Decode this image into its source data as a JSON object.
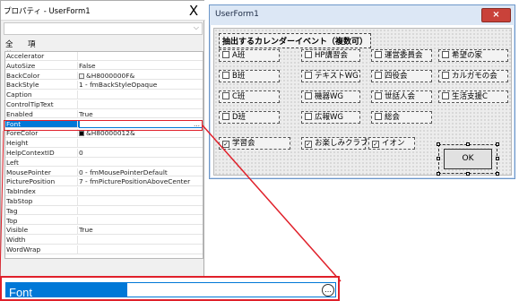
{
  "props": {
    "title": "プロパティ - UserForm1",
    "close": "X",
    "tabs": [
      "全体",
      "項目別"
    ],
    "rows": [
      {
        "name": "Accelerator",
        "value": ""
      },
      {
        "name": "AutoSize",
        "value": "False"
      },
      {
        "name": "BackColor",
        "value": "&H8000000F&",
        "swatch": "#f0f0f0"
      },
      {
        "name": "BackStyle",
        "value": "1 - fmBackStyleOpaque"
      },
      {
        "name": "Caption",
        "value": ""
      },
      {
        "name": "ControlTipText",
        "value": ""
      },
      {
        "name": "Enabled",
        "value": "True"
      },
      {
        "name": "Font",
        "value": "",
        "selected": true,
        "ellipsis": "…"
      },
      {
        "name": "ForeColor",
        "value": "&H80000012&",
        "swatch": "#000000"
      },
      {
        "name": "Height",
        "value": ""
      },
      {
        "name": "HelpContextID",
        "value": "0"
      },
      {
        "name": "Left",
        "value": ""
      },
      {
        "name": "MousePointer",
        "value": "0 - fmMousePointerDefault"
      },
      {
        "name": "PicturePosition",
        "value": "7 - fmPicturePositionAboveCenter"
      },
      {
        "name": "TabIndex",
        "value": ""
      },
      {
        "name": "TabStop",
        "value": ""
      },
      {
        "name": "Tag",
        "value": ""
      },
      {
        "name": "Top",
        "value": ""
      },
      {
        "name": "Visible",
        "value": "True"
      },
      {
        "name": "Width",
        "value": ""
      },
      {
        "name": "WordWrap",
        "value": ""
      }
    ]
  },
  "form": {
    "title": "UserForm1",
    "close": "×",
    "heading": "抽出するカレンダーイベント（複数可）",
    "checks": [
      {
        "label": "A班",
        "checked": false
      },
      {
        "label": "B班",
        "checked": false
      },
      {
        "label": "C班",
        "checked": false
      },
      {
        "label": "D班",
        "checked": false
      },
      {
        "label": "HP講習会",
        "checked": false
      },
      {
        "label": "テキストWG",
        "checked": false
      },
      {
        "label": "機器WG",
        "checked": false
      },
      {
        "label": "広報WG",
        "checked": false
      },
      {
        "label": "運営委員会",
        "checked": false
      },
      {
        "label": "四役会",
        "checked": false
      },
      {
        "label": "世話人会",
        "checked": false
      },
      {
        "label": "総会",
        "checked": false
      },
      {
        "label": "希望の家",
        "checked": false
      },
      {
        "label": "カルガモの会",
        "checked": false
      },
      {
        "label": "生活支援C",
        "checked": false
      },
      {
        "label": "学習会",
        "checked": true
      },
      {
        "label": "お楽しみクラブ",
        "checked": true
      },
      {
        "label": "イオン",
        "checked": true
      }
    ],
    "ok": "OK"
  },
  "zoom": {
    "label": "Font",
    "ellipsis": "..."
  },
  "colors": {
    "highlight": "#e0202a",
    "selection": "#0078d7",
    "form_close": "#c9423a"
  }
}
